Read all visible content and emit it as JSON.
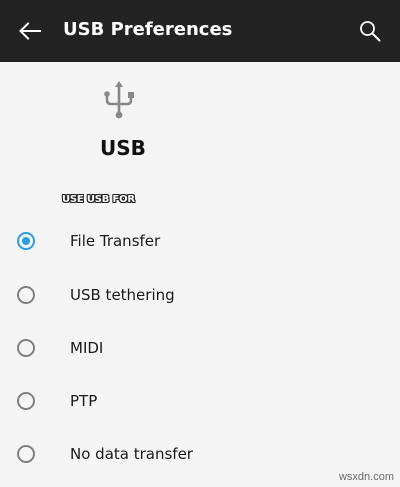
{
  "toolbar": {
    "title": "USB Preferences",
    "back_icon": "arrow-left-icon",
    "search_icon": "search-icon",
    "background": "#232323"
  },
  "header": {
    "icon": "usb-icon",
    "title": "USB"
  },
  "section": {
    "label": "USE USB FOR"
  },
  "options": [
    {
      "label": "File Transfer",
      "selected": true
    },
    {
      "label": "USB tethering",
      "selected": false
    },
    {
      "label": "MIDI",
      "selected": false
    },
    {
      "label": "PTP",
      "selected": false
    },
    {
      "label": "No data transfer",
      "selected": false
    }
  ],
  "accent_color": "#2a9ee4",
  "watermark": "wsxdn.com"
}
